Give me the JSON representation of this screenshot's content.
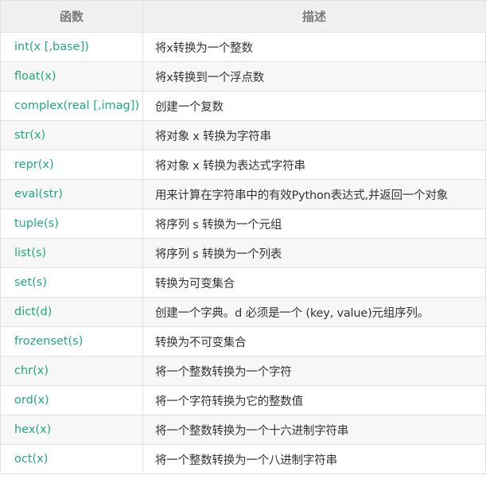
{
  "table": {
    "headers": [
      "函数",
      "描述"
    ],
    "rows": [
      {
        "func": "int(x [,base])",
        "desc": "将x转换为一个整数"
      },
      {
        "func": "float(x)",
        "desc": "将x转换到一个浮点数"
      },
      {
        "func": "complex(real [,imag])",
        "desc": "创建一个复数"
      },
      {
        "func": "str(x)",
        "desc": "将对象 x 转换为字符串"
      },
      {
        "func": "repr(x)",
        "desc": "将对象 x 转换为表达式字符串"
      },
      {
        "func": "eval(str)",
        "desc": "用来计算在字符串中的有效Python表达式,并返回一个对象"
      },
      {
        "func": "tuple(s)",
        "desc": "将序列 s 转换为一个元组"
      },
      {
        "func": "list(s)",
        "desc": "将序列 s 转换为一个列表"
      },
      {
        "func": "set(s)",
        "desc": "转换为可变集合"
      },
      {
        "func": "dict(d)",
        "desc": "创建一个字典。d 必须是一个 (key, value)元组序列。"
      },
      {
        "func": "frozenset(s)",
        "desc": "转换为不可变集合"
      },
      {
        "func": "chr(x)",
        "desc": "将一个整数转换为一个字符"
      },
      {
        "func": "ord(x)",
        "desc": "将一个字符转换为它的整数值"
      },
      {
        "func": "hex(x)",
        "desc": "将一个整数转换为一个十六进制字符串"
      },
      {
        "func": "oct(x)",
        "desc": "将一个整数转换为一个八进制字符串"
      }
    ]
  },
  "colors": {
    "function_text": "#20a880",
    "header_bg": "#f0f0f0",
    "header_text": "#777777",
    "stripe_bg": "#f7f7f7",
    "border": "#e1e1e1"
  }
}
